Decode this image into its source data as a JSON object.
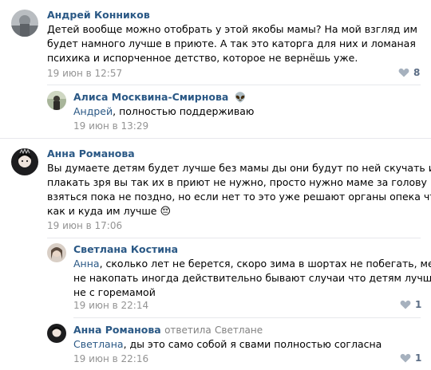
{
  "comments": [
    {
      "author": "Андрей Конников",
      "lines": [
        "Детей вообще можно отобрать у этой якобы мамы? На мой взгляд им",
        "будет намного лучше в приюте. А так это каторга для них и ломаная",
        "психика и испорченное детство, которое не вернёшь уже."
      ],
      "date": "19 июн в 12:57",
      "likes": "8"
    },
    {
      "author": "Алиса Москвина-Смирнова",
      "author_emoji": "👽",
      "mention": "Андрей",
      "text": ", полностью поддерживаю",
      "date": "19 июн в 13:29"
    },
    {
      "author": "Анна Романова",
      "lines": [
        "Вы думаете детям будет лучше без мамы ды они будут по ней скучать и",
        "плакать зря вы так их в приют не нужно, просто нужно маме за голову",
        "взяться пока не поздно, но если нет то это уже решают органы опека что и",
        "как и куда им лучше"
      ],
      "emoji": "😔",
      "date": "19 июн в 17:06"
    },
    {
      "author": "Светлана Костина",
      "mention": "Анна",
      "lines": [
        ", сколько лет не берется, скоро зима в шортах не побегать, метал",
        "не накопать иногда действительно бывают случаи что детям лучше",
        "не с горемамой"
      ],
      "date": "19 июн в 22:14",
      "likes": "1"
    },
    {
      "author": "Анна Романова",
      "replied_to_label": "ответила",
      "replied_to_name": "Светлане",
      "mention": "Светлана",
      "text": ", ды это само собой я свами полностью согласна",
      "date": "19 июн в 22:16",
      "likes": "1"
    }
  ],
  "colors": {
    "link": "#2a5885",
    "meta": "#939393",
    "separator": "#e7e8ec"
  }
}
